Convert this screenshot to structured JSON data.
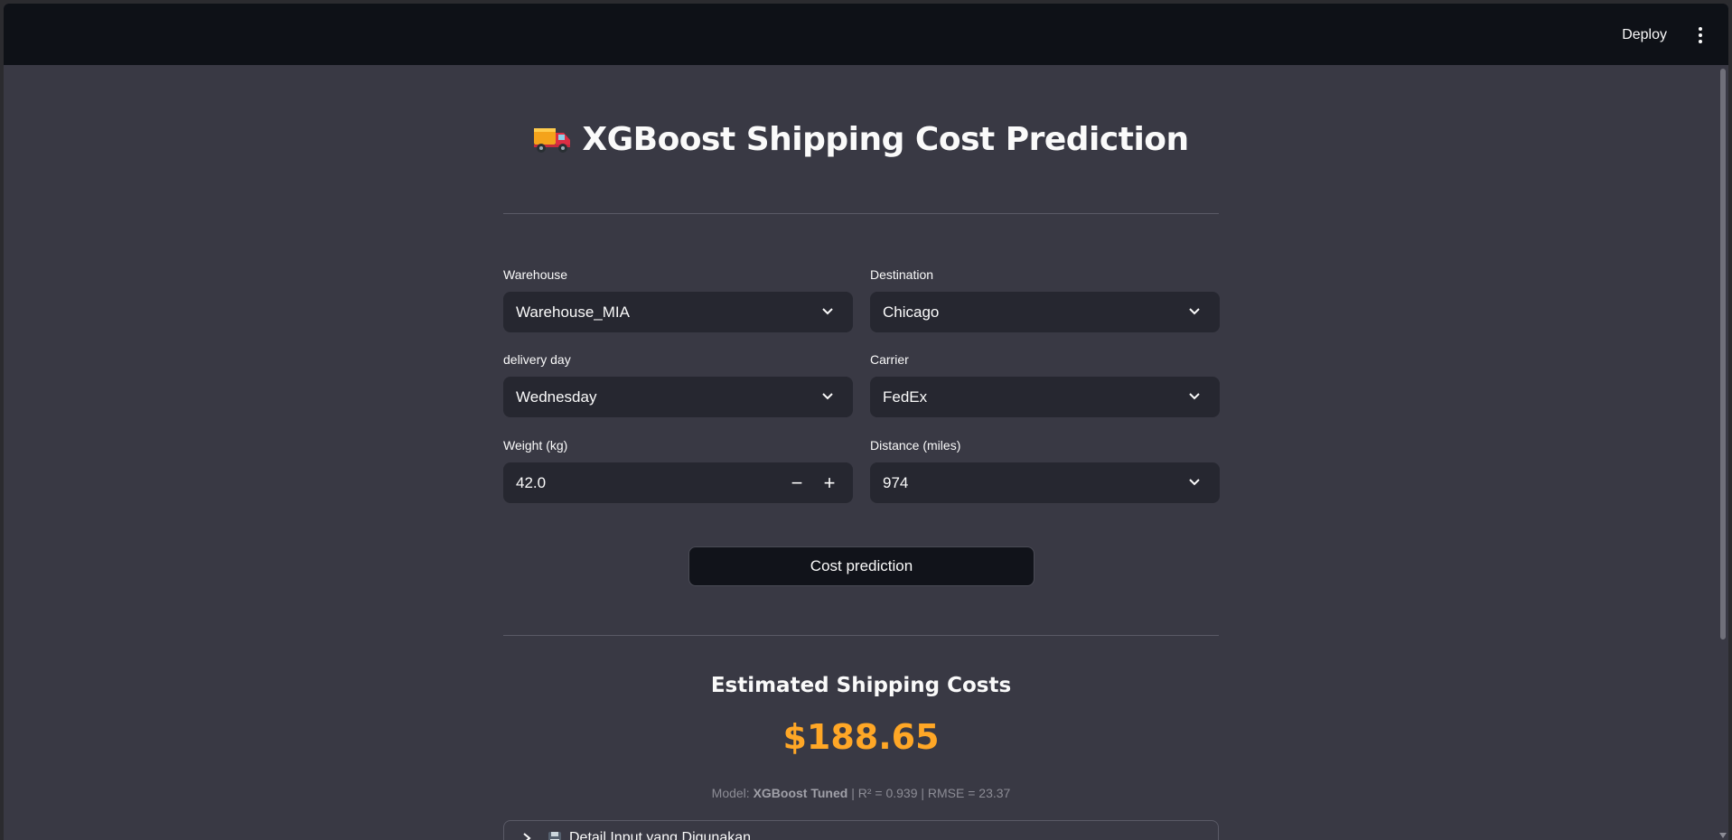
{
  "header": {
    "deploy_label": "Deploy",
    "menu_icon": "kebab-menu-icon"
  },
  "main": {
    "title": "XGBoost Shipping Cost Prediction",
    "title_icon": "truck-icon",
    "fields": {
      "warehouse": {
        "label": "Warehouse",
        "value": "Warehouse_MIA"
      },
      "destination": {
        "label": "Destination",
        "value": "Chicago"
      },
      "delivery_day": {
        "label": "delivery day",
        "value": "Wednesday"
      },
      "carrier": {
        "label": "Carrier",
        "value": "FedEx"
      },
      "weight": {
        "label": "Weight (kg)",
        "value": "42.0",
        "minus": "−",
        "plus": "+"
      },
      "distance": {
        "label": "Distance (miles)",
        "value": "974"
      }
    },
    "predict_button": "Cost prediction",
    "result": {
      "title": "Estimated Shipping Costs",
      "price": "$188.65",
      "model_prefix": "Model: ",
      "model_name": "XGBoost Tuned",
      "model_metrics": " | R² = 0.939 | RMSE = 23.37"
    },
    "expander": {
      "label": "Detail Input yang Digunakan",
      "icon": "floppy-disk-icon"
    }
  },
  "colors": {
    "background": "#393944",
    "topbar": "#0e1117",
    "input": "#262730",
    "accent": "#ffa726"
  }
}
